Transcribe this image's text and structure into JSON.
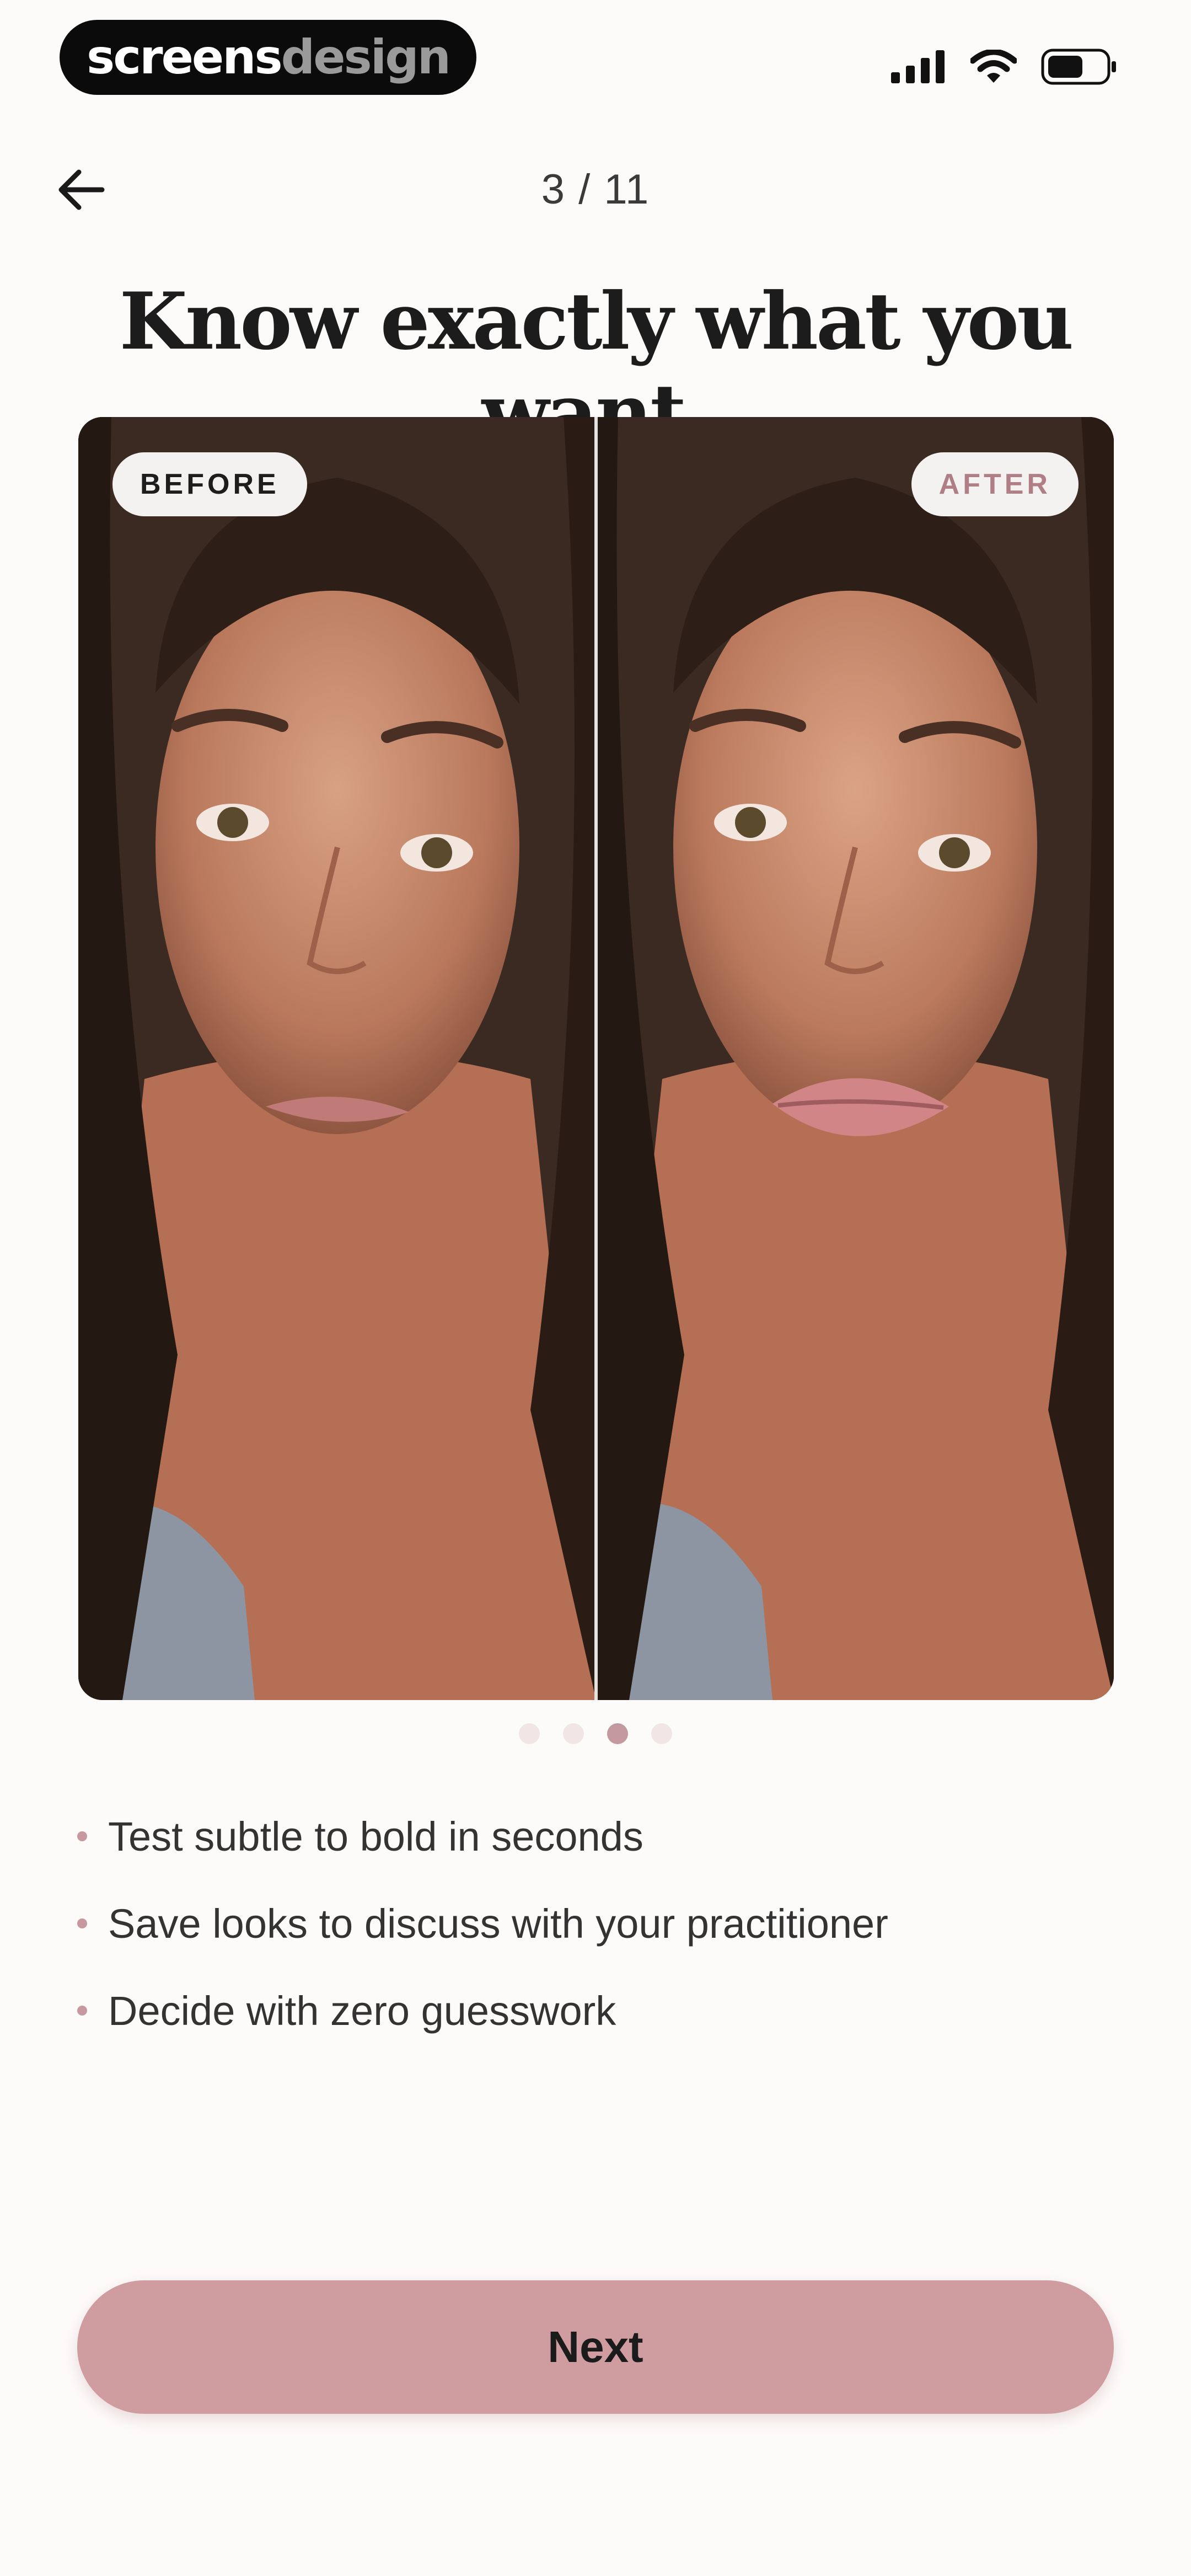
{
  "brand": {
    "part1": "screens",
    "part2": "design"
  },
  "status": {
    "signal_icon": "signal-bars-icon",
    "wifi_icon": "wifi-icon",
    "battery_icon": "battery-icon"
  },
  "nav": {
    "back_icon": "arrow-left-icon",
    "step": "3 / 11"
  },
  "title": "Know exactly what you want.",
  "comparison": {
    "before_label": "BEFORE",
    "after_label": "AFTER"
  },
  "pagination": {
    "total": 4,
    "active_index": 2
  },
  "benefits": [
    "Test subtle to bold in seconds",
    "Save looks to discuss with your practitioner",
    "Decide with zero guesswork"
  ],
  "cta": {
    "label": "Next"
  },
  "colors": {
    "accent": "#cf9ca0",
    "accent_text": "#b07f85",
    "background": "#fdfbfa",
    "title": "#1c1c1c"
  }
}
